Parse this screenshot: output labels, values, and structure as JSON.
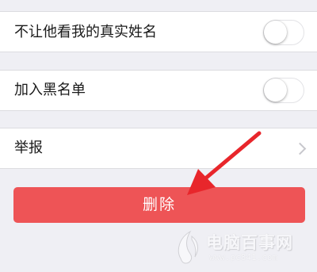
{
  "settings": {
    "hide_real_name": {
      "label": "不让他看我的真实姓名",
      "enabled": false
    },
    "blacklist": {
      "label": "加入黑名单",
      "enabled": false
    },
    "report": {
      "label": "举报"
    }
  },
  "delete_button": {
    "label": "删除"
  },
  "colors": {
    "background": "#efeff4",
    "delete_button": "#ee5456",
    "arrow": "#e8262b"
  },
  "icons": {
    "report_chevron": "chevron-right-icon",
    "annotation": "red-arrow-icon"
  },
  "watermark": {
    "name": "电脑百事网",
    "url": "www.pc841.com"
  }
}
